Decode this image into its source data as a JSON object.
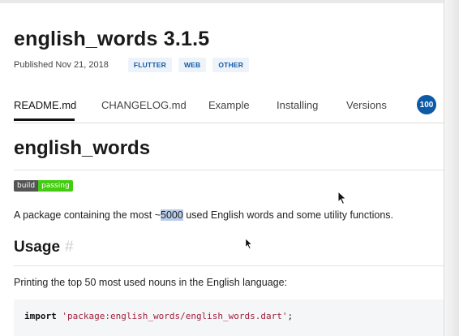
{
  "package": {
    "title": "english_words 3.1.5",
    "published": "Published Nov 21, 2018",
    "tags": [
      "FLUTTER",
      "WEB",
      "OTHER"
    ]
  },
  "tabs": [
    {
      "label": "README.md",
      "active": true
    },
    {
      "label": "CHANGELOG.md",
      "active": false
    },
    {
      "label": "Example",
      "active": false
    },
    {
      "label": "Installing",
      "active": false
    },
    {
      "label": "Versions",
      "active": false
    }
  ],
  "score": "100",
  "readme": {
    "title": "english_words",
    "badge_left": "build",
    "badge_right": "passing",
    "desc_before": "A package containing the most ~",
    "desc_highlight": "5000",
    "desc_after": " used English words and some utility functions.",
    "usage_heading": "Usage",
    "usage_anchor": "#",
    "printing": "Printing the top 50 most used nouns in the English language:",
    "code_keyword": "import",
    "code_string": "'package:english_words/english_words.dart'",
    "code_end": ";"
  },
  "colors": {
    "accent": "#0d5aa7",
    "tag_bg": "#eef3fa",
    "badge_pass": "#44cc11",
    "highlight": "#b9cde9",
    "code_string": "#a0213d"
  }
}
